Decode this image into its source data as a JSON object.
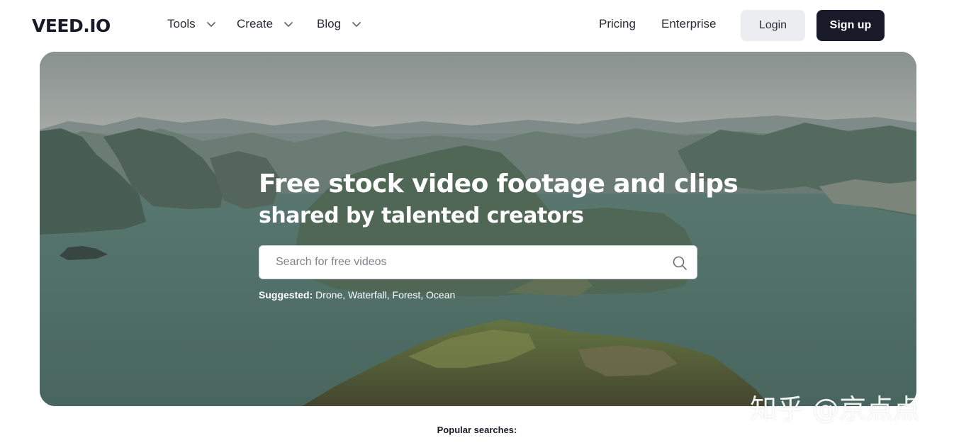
{
  "header": {
    "logo": "VEED.IO",
    "nav": {
      "tools": "Tools",
      "create": "Create",
      "blog": "Blog",
      "pricing": "Pricing",
      "enterprise": "Enterprise"
    },
    "login": "Login",
    "signup": "Sign up"
  },
  "hero": {
    "title": "Free stock video footage and clips",
    "subtitle": "shared by talented creators",
    "search_placeholder": "Search for free videos",
    "suggested_label": "Suggested:",
    "suggestions": [
      "Drone",
      "Waterfall",
      "Forest",
      "Ocean"
    ]
  },
  "watermark": "知乎 @京点点",
  "popular_searches": "Popular searches:",
  "colors": {
    "brand_dark": "#181a29",
    "login_bg": "#ecedf0"
  },
  "icons": [
    "chevron-down-icon",
    "search-icon"
  ]
}
